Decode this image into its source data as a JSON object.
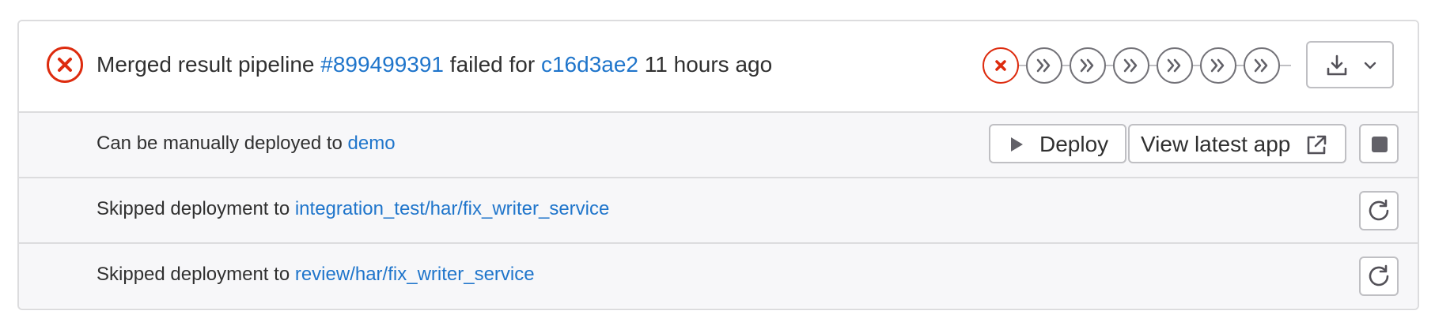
{
  "pipeline": {
    "prefix": "Merged result pipeline",
    "id_link": "#899499391",
    "middle": "failed for",
    "commit_link": "c16d3ae2",
    "time_ago": "11 hours ago",
    "status": "failed",
    "status_icon": "status-failed-icon",
    "status_color": "#dd2b0e",
    "stages": [
      {
        "status": "failed",
        "icon": "close-icon"
      },
      {
        "status": "skipped",
        "icon": "chevron-double-right-icon"
      },
      {
        "status": "skipped",
        "icon": "chevron-double-right-icon"
      },
      {
        "status": "skipped",
        "icon": "chevron-double-right-icon"
      },
      {
        "status": "skipped",
        "icon": "chevron-double-right-icon"
      },
      {
        "status": "skipped",
        "icon": "chevron-double-right-icon"
      },
      {
        "status": "skipped",
        "icon": "chevron-double-right-icon"
      }
    ],
    "download_icon": "download-icon",
    "dropdown_icon": "chevron-down-icon"
  },
  "deployments": [
    {
      "text": "Can be manually deployed to",
      "env_link": "demo",
      "actions": {
        "deploy_label": "Deploy",
        "deploy_icon": "play-icon",
        "view_label": "View latest app",
        "view_icon": "external-link-icon",
        "stop_icon": "stop-icon"
      }
    },
    {
      "text": "Skipped deployment to",
      "env_link": "integration_test/har/fix_writer_service",
      "actions": {
        "retry_icon": "retry-icon"
      }
    },
    {
      "text": "Skipped deployment to",
      "env_link": "review/har/fix_writer_service",
      "actions": {
        "retry_icon": "retry-icon"
      }
    }
  ],
  "colors": {
    "link": "#1f75cb",
    "failed": "#dd2b0e",
    "skipped": "#737278",
    "row_bg": "#f7f7f9",
    "border": "#dcdcde"
  }
}
